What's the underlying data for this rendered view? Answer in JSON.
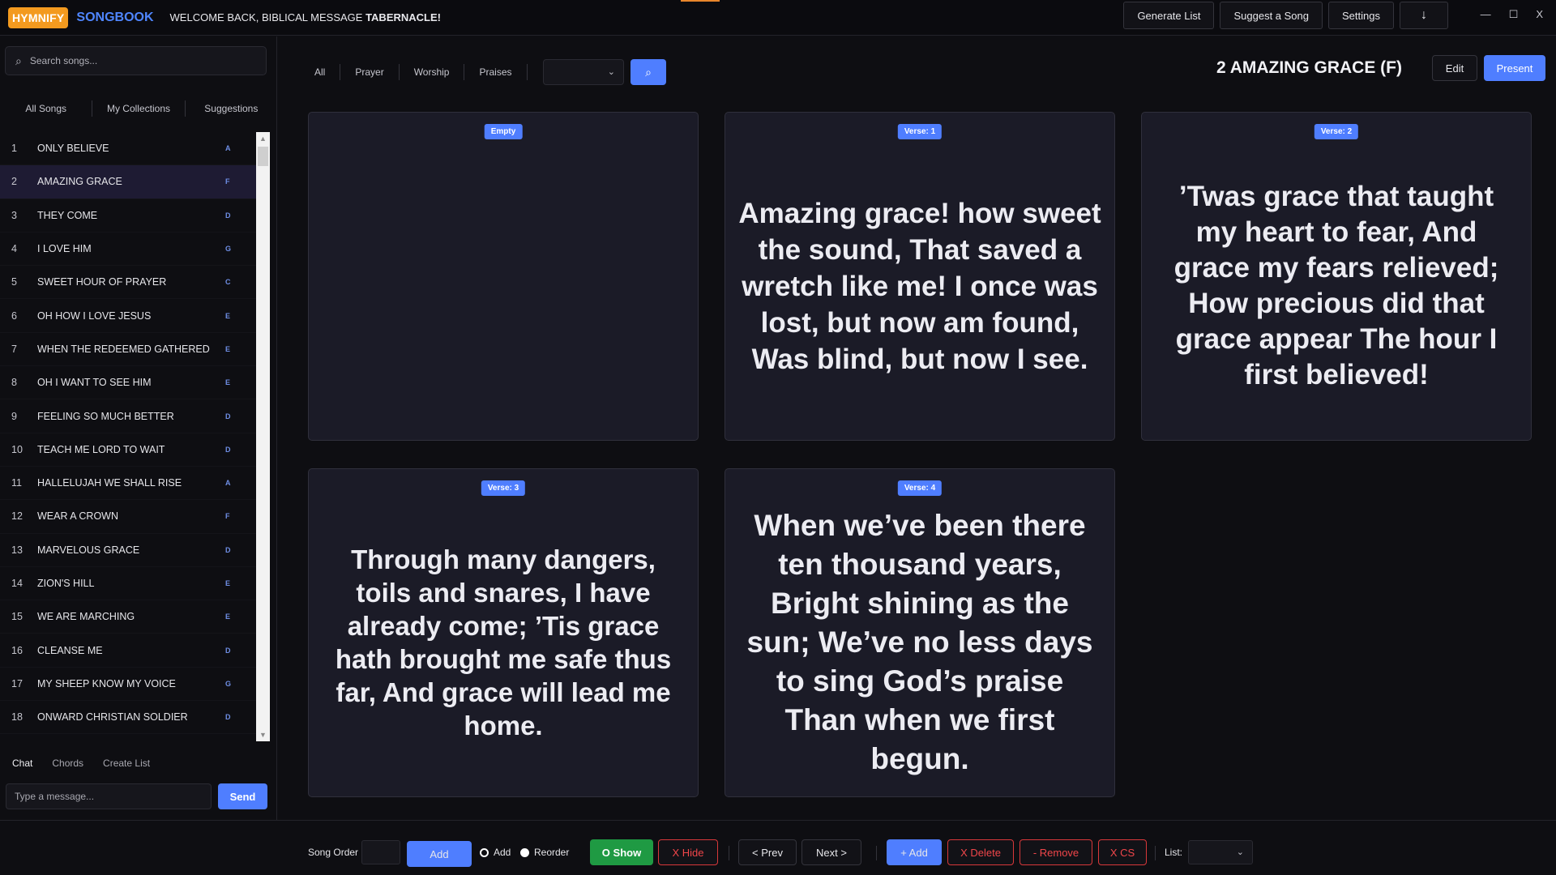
{
  "header": {
    "logo_box": "HYMNIFY",
    "logo_text": "SONGBOOK",
    "welcome_prefix": "WELCOME BACK, BIBLICAL MESSAGE ",
    "welcome_name": "TABERNACLE!",
    "buttons": [
      "Generate List",
      "Suggest a Song",
      "Settings"
    ],
    "download_icon": "↓",
    "window": {
      "minimize": "—",
      "maximize": "☐",
      "close": "X"
    }
  },
  "sidebar": {
    "search_placeholder": "Search songs...",
    "tabs": [
      "All Songs",
      "My Collections",
      "Suggestions"
    ],
    "songs": [
      {
        "num": "1",
        "title": "ONLY BELIEVE",
        "key": "A"
      },
      {
        "num": "2",
        "title": "AMAZING GRACE",
        "key": "F"
      },
      {
        "num": "3",
        "title": "THEY COME",
        "key": "D"
      },
      {
        "num": "4",
        "title": "I LOVE HIM",
        "key": "G"
      },
      {
        "num": "5",
        "title": "SWEET HOUR OF PRAYER",
        "key": "C"
      },
      {
        "num": "6",
        "title": "OH HOW I LOVE JESUS",
        "key": "E"
      },
      {
        "num": "7",
        "title": "WHEN THE REDEEMED GATHERED",
        "key": "E"
      },
      {
        "num": "8",
        "title": "OH I WANT TO SEE HIM",
        "key": "E"
      },
      {
        "num": "9",
        "title": "FEELING SO MUCH BETTER",
        "key": "D"
      },
      {
        "num": "10",
        "title": "TEACH ME LORD TO WAIT",
        "key": "D"
      },
      {
        "num": "11",
        "title": "HALLELUJAH WE SHALL RISE",
        "key": "A"
      },
      {
        "num": "12",
        "title": "WEAR A CROWN",
        "key": "F"
      },
      {
        "num": "13",
        "title": "MARVELOUS GRACE",
        "key": "D"
      },
      {
        "num": "14",
        "title": "ZION'S HILL",
        "key": "E"
      },
      {
        "num": "15",
        "title": "WE ARE MARCHING",
        "key": "E"
      },
      {
        "num": "16",
        "title": "CLEANSE ME",
        "key": "D"
      },
      {
        "num": "17",
        "title": "MY SHEEP KNOW MY VOICE",
        "key": "G"
      },
      {
        "num": "18",
        "title": "ONWARD CHRISTIAN SOLDIER",
        "key": "D"
      }
    ],
    "active_index": 1,
    "chat_tabs": [
      "Chat",
      "Chords",
      "Create List"
    ],
    "chat_placeholder": "Type a message...",
    "send_label": "Send"
  },
  "main": {
    "filters": [
      "All",
      "Prayer",
      "Worship",
      "Praises"
    ],
    "song_title": "2 AMAZING GRACE (F)",
    "edit_label": "Edit",
    "present_label": "Present",
    "cards": [
      {
        "badge": "Empty",
        "text": ""
      },
      {
        "badge": "Verse: 1",
        "text": "Amazing grace! how sweet the sound, That saved a wretch like me! I once was lost, but now am found, Was blind, but now I see."
      },
      {
        "badge": "Verse: 2",
        "text": "’Twas grace that taught my heart to fear, And grace my fears relieved; How precious did that grace appear The hour I first believed!"
      },
      {
        "badge": "Verse: 3",
        "text": "Through many dangers, toils and snares, I have already come; ’Tis grace hath brought me safe thus far, And grace will lead me home."
      },
      {
        "badge": "Verse: 4",
        "text": "When we’ve been there ten thousand years, Bright shining as the sun; We’ve no less days to sing God’s praise Than when we first begun."
      }
    ]
  },
  "bottom": {
    "song_order_label": "Song Order",
    "add_label": "Add",
    "radio_add": "Add",
    "radio_reorder": "Reorder",
    "show_label": "O Show",
    "hide_label": "X Hide",
    "prev_label": "< Prev",
    "next_label": "Next >",
    "plus_add_label": "+ Add",
    "delete_label": "X Delete",
    "remove_label": "- Remove",
    "cs_label": "X CS",
    "list_label": "List:"
  },
  "colors": {
    "accent": "#4f7eff",
    "logo": "#f39a1f",
    "danger": "#d8383a",
    "success": "#1f9a43"
  }
}
